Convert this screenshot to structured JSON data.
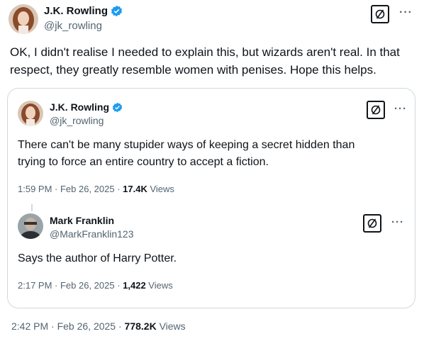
{
  "tweet": {
    "author_name": "J.K. Rowling",
    "author_handle": "@jk_rowling",
    "text_line1": "OK, I didn't realise I needed to explain this, but wizards aren't real. In that",
    "text_line2": "respect, they greatly resemble women with penises. Hope this helps.",
    "time": "2:42 PM · Feb 26, 2025 · ",
    "views_count": "778.2K",
    "views_label": " Views",
    "more_icon": "more-dots-icon",
    "block_icon": "block-icon"
  },
  "quote": {
    "author_name": "J.K. Rowling",
    "author_handle": "@jk_rowling",
    "text_line1": "There can't be many stupider ways of keeping a secret hidden than",
    "text_line2": "trying to force an entire country to accept a fiction.",
    "time": "1:59 PM · Feb 26, 2025 · ",
    "views_count": "17.4K",
    "views_label": " Views"
  },
  "reply": {
    "author_name": "Mark Franklin",
    "author_handle": "@MarkFranklin123",
    "text": "Says the author of Harry Potter.",
    "time": "2:17 PM · Feb 26, 2025 · ",
    "views_count": "1,422",
    "views_label": " Views"
  },
  "colors": {
    "verified": "#1d9bf0",
    "secondary_text": "#536471",
    "border": "#cfd9de"
  }
}
